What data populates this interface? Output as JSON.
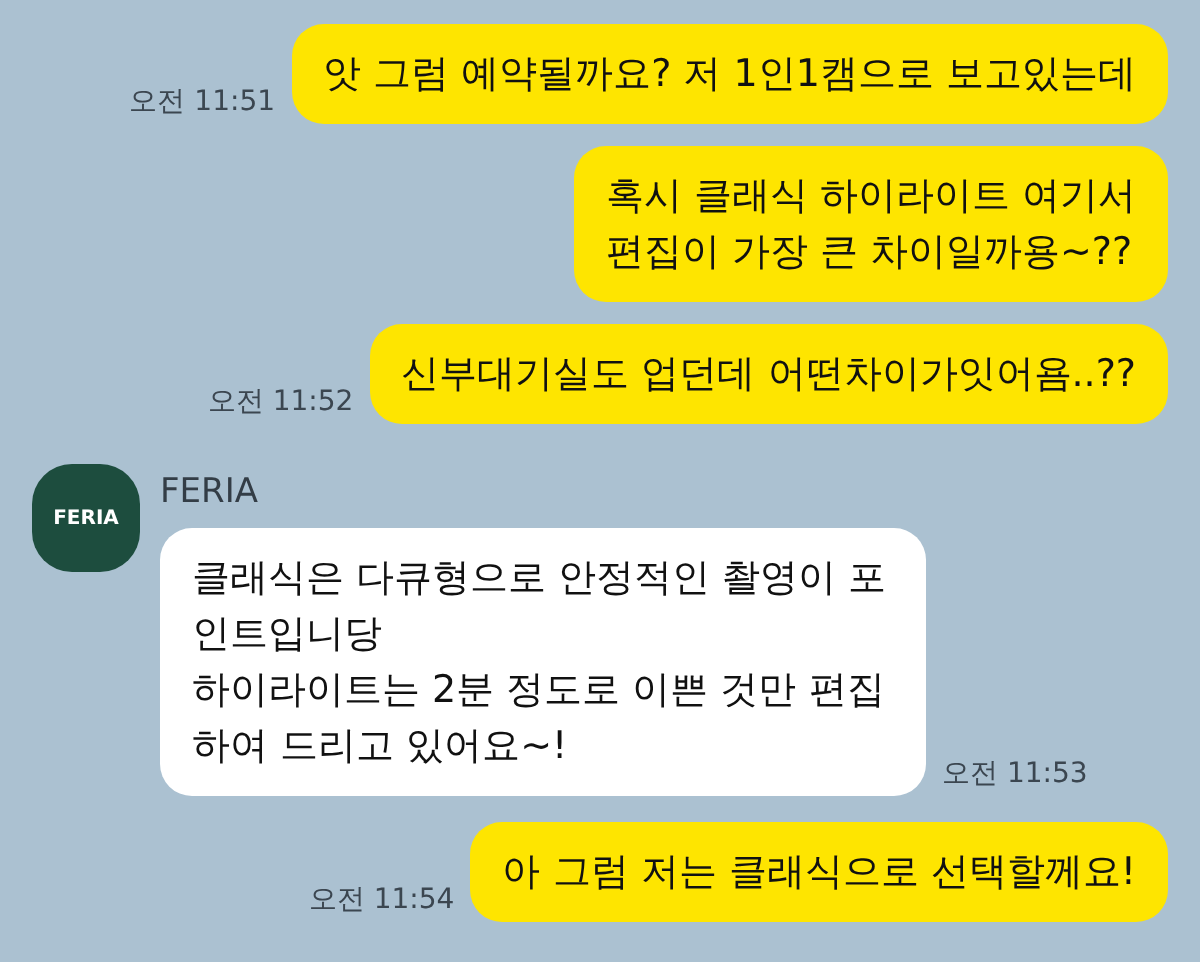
{
  "messages": [
    {
      "kind": "sent",
      "text": "앗 그럼 예약될까요? 저 1인1캠으로 보고있는데",
      "time": "오전 11:51"
    },
    {
      "kind": "sent",
      "text": "혹시 클래식 하이라이트 여기서\n편집이 가장 큰 차이일까용~??"
    },
    {
      "kind": "sent",
      "text": "신부대기실도 업던데 어떤차이가잇어욤..??",
      "time": "오전 11:52"
    },
    {
      "kind": "received",
      "sender": "FERIA",
      "avatar": "FERIA",
      "text": "클래식은 다큐형으로 안정적인 촬영이 포인트입니당\n하이라이트는 2분 정도로 이쁜 것만 편집하여 드리고 있어요~!",
      "time": "오전 11:53"
    },
    {
      "kind": "sent",
      "text": "아 그럼 저는 클래식으로 선택할께요!",
      "time": "오전 11:54"
    }
  ]
}
